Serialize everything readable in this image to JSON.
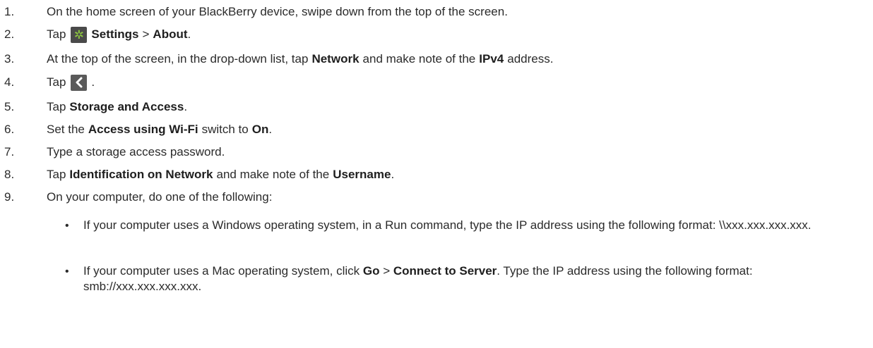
{
  "steps": [
    {
      "num": "1.",
      "text": "On the home screen of your BlackBerry device, swipe down from the top of the screen."
    },
    {
      "num": "2.",
      "t1": "Tap",
      "icon": "gear-icon",
      "b1": "Settings",
      "t2": " > ",
      "b2": "About",
      "t3": "."
    },
    {
      "num": "3.",
      "t1": "At the top of the screen, in the drop-down list, tap ",
      "b1": "Network",
      "t2": " and make note of the ",
      "b2": "IPv4",
      "t3": " address."
    },
    {
      "num": "4.",
      "t1": "Tap",
      "icon": "back-icon",
      "t2": "."
    },
    {
      "num": "5.",
      "t1": "Tap ",
      "b1": "Storage and Access",
      "t2": "."
    },
    {
      "num": "6.",
      "t1": "Set the ",
      "b1": "Access using Wi-Fi",
      "t2": " switch to ",
      "b2": "On",
      "t3": "."
    },
    {
      "num": "7.",
      "text": "Type a storage access password."
    },
    {
      "num": "8.",
      "t1": "Tap ",
      "b1": "Identification on Network",
      "t2": " and make note of the ",
      "b2": "Username",
      "t3": "."
    },
    {
      "num": "9.",
      "text": "On your computer, do one of the following:"
    }
  ],
  "bullets": [
    {
      "symbol": "•",
      "t1": "If your computer uses a Windows operating system, in a Run command, type the IP address using the following format: \\\\xxx.xxx.xxx.xxx."
    },
    {
      "symbol": "•",
      "t1": "If your computer uses a Mac operating system, click ",
      "b1": "Go",
      "t2": " > ",
      "b2": "Connect to Server",
      "t3": ". Type the IP address using the following format: smb://xxx.xxx.xxx.xxx."
    }
  ],
  "icons": {
    "gear_color": "#8cc63f",
    "tile_color": "#4a4a4a"
  }
}
